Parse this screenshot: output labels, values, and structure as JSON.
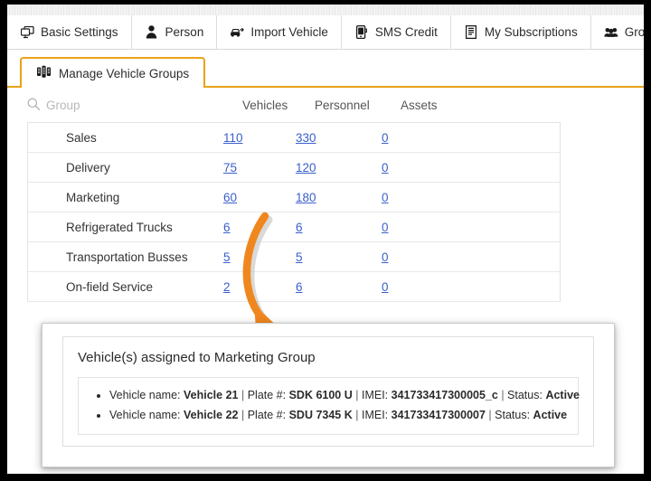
{
  "main_tabs": [
    {
      "label": "Basic Settings",
      "icon": "monitor-icon",
      "active": false
    },
    {
      "label": "Person",
      "icon": "person-icon",
      "active": false
    },
    {
      "label": "Import Vehicle",
      "icon": "car-icon",
      "active": false
    },
    {
      "label": "SMS Credit",
      "icon": "mobile-icon",
      "active": false
    },
    {
      "label": "My Subscriptions",
      "icon": "list-icon",
      "active": false
    },
    {
      "label": "Groups",
      "icon": "users-icon",
      "active": true
    }
  ],
  "sub_tab": {
    "label": "Manage Vehicle Groups",
    "icon": "vehicle-group-icon",
    "accent_color": "#e8a317"
  },
  "table": {
    "search": {
      "placeholder": "Group",
      "value": "",
      "icon": "search-icon"
    },
    "columns": [
      "Vehicles",
      "Personnel",
      "Assets"
    ],
    "rows": [
      {
        "name": "Sales",
        "vehicles": "110",
        "personnel": "330",
        "assets": "0"
      },
      {
        "name": "Delivery",
        "vehicles": "75",
        "personnel": "120",
        "assets": "0"
      },
      {
        "name": "Marketing",
        "vehicles": "60",
        "personnel": "180",
        "assets": "0"
      },
      {
        "name": "Refrigerated Trucks",
        "vehicles": "6",
        "personnel": "6",
        "assets": "0"
      },
      {
        "name": "Transportation Busses",
        "vehicles": "5",
        "personnel": "5",
        "assets": "0"
      },
      {
        "name": "On-field Service",
        "vehicles": "2",
        "personnel": "6",
        "assets": "0"
      }
    ],
    "link_color": "#3a5fcd"
  },
  "annotation": {
    "arrow_color": "#f0871e",
    "from_label": "60",
    "to": "popup"
  },
  "popup": {
    "title": "Vehicle(s) assigned to Marketing Group",
    "vehicles": [
      {
        "name_label": "Vehicle name:",
        "name": "Vehicle 21",
        "plate_label": "Plate #:",
        "plate": "SDK 6100 U",
        "imei_label": "IMEI:",
        "imei": "341733417300005_c",
        "status_label": "Status:",
        "status": "Active"
      },
      {
        "name_label": "Vehicle name:",
        "name": "Vehicle 22",
        "plate_label": "Plate #:",
        "plate": "SDU 7345 K",
        "imei_label": "IMEI:",
        "imei": "341733417300007",
        "status_label": "Status:",
        "status": "Active"
      }
    ]
  }
}
